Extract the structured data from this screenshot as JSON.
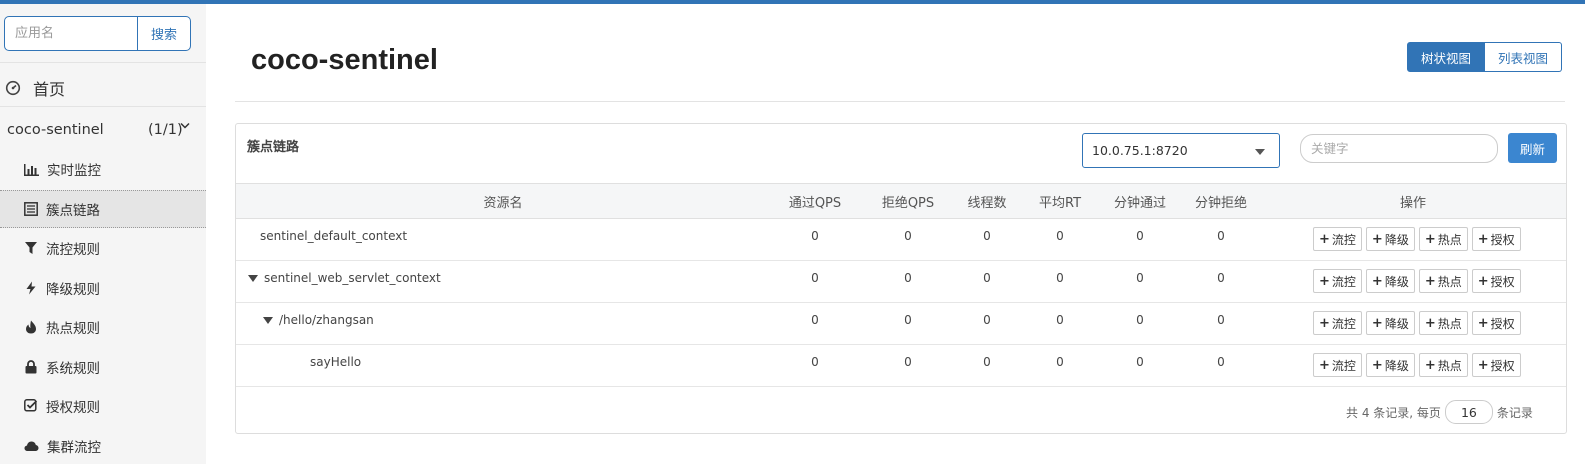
{
  "colors": {
    "primary": "#3174b6",
    "sidebar_bg": "#f5f5f5"
  },
  "sidebar": {
    "search": {
      "placeholder": "应用名",
      "button_label": "搜索"
    },
    "home_label": "首页",
    "app": {
      "name": "coco-sentinel",
      "count": "(1/1)"
    },
    "items": [
      {
        "label": "实时监控",
        "icon": "bar-chart-icon"
      },
      {
        "label": "簇点链路",
        "icon": "list-icon"
      },
      {
        "label": "流控规则",
        "icon": "filter-icon"
      },
      {
        "label": "降级规则",
        "icon": "flash-icon"
      },
      {
        "label": "热点规则",
        "icon": "fire-icon"
      },
      {
        "label": "系统规则",
        "icon": "lock-icon"
      },
      {
        "label": "授权规则",
        "icon": "check-icon"
      },
      {
        "label": "集群流控",
        "icon": "cloud-icon"
      }
    ]
  },
  "header": {
    "title": "coco-sentinel",
    "view_tree_label": "树状视图",
    "view_list_label": "列表视图"
  },
  "panel": {
    "title": "簇点链路",
    "machine": "10.0.75.1:8720",
    "keyword_placeholder": "关键字",
    "refresh_label": "刷新",
    "columns": [
      "资源名",
      "通过QPS",
      "拒绝QPS",
      "线程数",
      "平均RT",
      "分钟通过",
      "分钟拒绝",
      "操作"
    ],
    "op_labels": [
      "流控",
      "降级",
      "热点",
      "授权"
    ],
    "rows": [
      {
        "name": "sentinel_default_context",
        "depth": 0,
        "expandable": false,
        "values": [
          "0",
          "0",
          "0",
          "0",
          "0",
          "0"
        ]
      },
      {
        "name": "sentinel_web_servlet_context",
        "depth": 0,
        "expandable": true,
        "values": [
          "0",
          "0",
          "0",
          "0",
          "0",
          "0"
        ]
      },
      {
        "name": "/hello/zhangsan",
        "depth": 1,
        "expandable": true,
        "values": [
          "0",
          "0",
          "0",
          "0",
          "0",
          "0"
        ]
      },
      {
        "name": "sayHello",
        "depth": 2,
        "expandable": false,
        "values": [
          "0",
          "0",
          "0",
          "0",
          "0",
          "0"
        ]
      }
    ],
    "pager": {
      "prefix": "共 4 条记录, 每页",
      "page_size": "16",
      "suffix": "条记录"
    }
  }
}
